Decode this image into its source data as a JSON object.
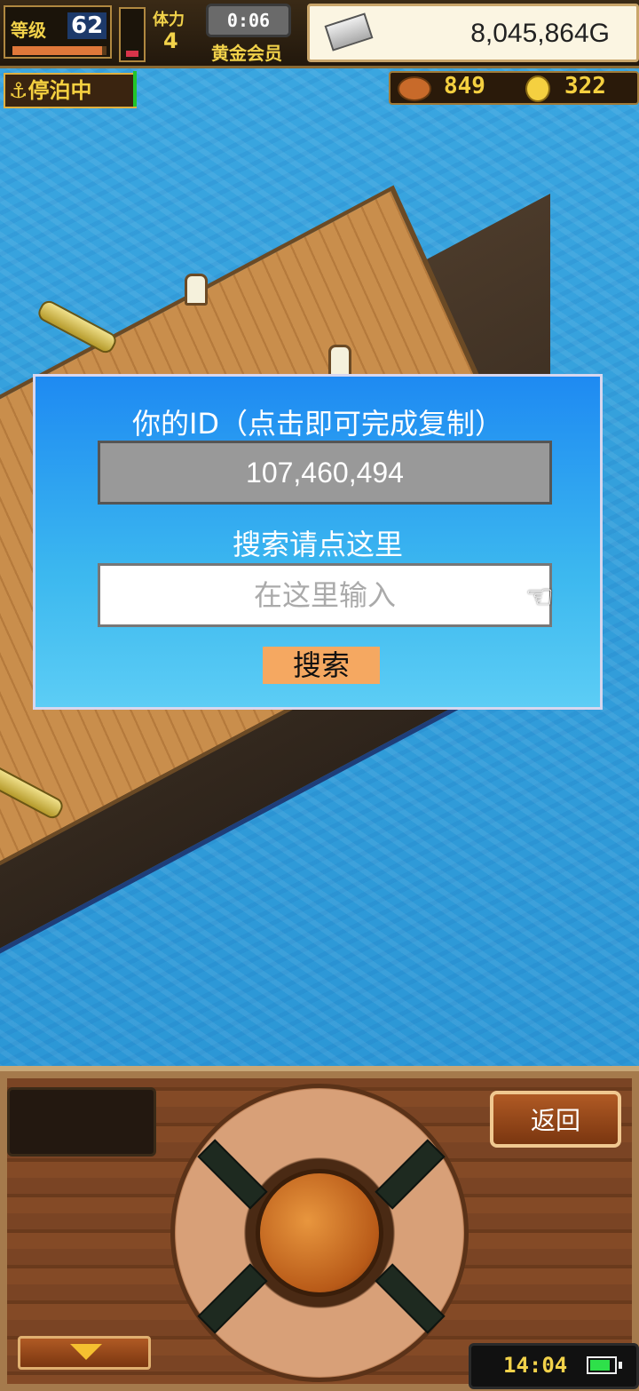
{
  "status": {
    "level_label": "等级",
    "level": "62",
    "level_progress": 0.95,
    "hp_level": 0.15,
    "stamina_label": "体力",
    "stamina": "4",
    "timer": "0:06",
    "membership": "黄金会员",
    "gold": "8,045,864G",
    "docked": "⚓停泊中",
    "resource1": "849",
    "resource2": "322"
  },
  "dialog": {
    "title": "你的ID（点击即可完成复制）",
    "id_value": "107,460,494",
    "search_label": "搜索请点这里",
    "input_placeholder": "在这里输入",
    "input_value": "",
    "search_button": "搜索"
  },
  "bottom": {
    "back_button": "返回",
    "clock": "14:04",
    "battery_level": 0.85
  },
  "colors": {
    "dialog_top": "#1e8af2",
    "dialog_bottom": "#5ccdf5",
    "search_button": "#f5a861",
    "id_box": "#999999"
  },
  "icons": {
    "anchor": "anchor-icon",
    "pointer": "pointing-hand-icon",
    "down": "down-arrow-icon",
    "battery": "battery-icon"
  }
}
